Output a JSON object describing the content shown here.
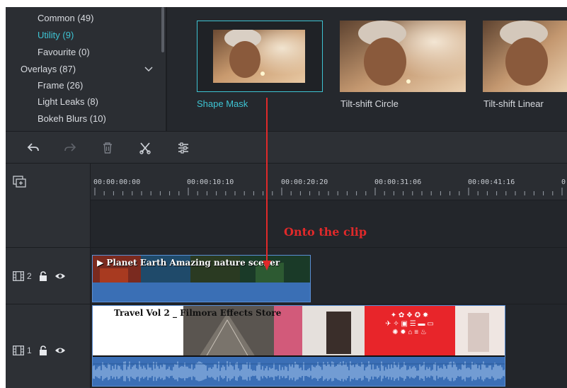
{
  "categories": [
    {
      "label": "Common (49)",
      "active": false
    },
    {
      "label": "Utility (9)",
      "active": true
    },
    {
      "label": "Favourite (0)",
      "active": false
    },
    {
      "label": "Overlays (87)",
      "active": false
    },
    {
      "label": "Frame (26)",
      "active": false
    },
    {
      "label": "Light Leaks (8)",
      "active": false
    },
    {
      "label": "Bokeh Blurs (10)",
      "active": false
    }
  ],
  "effects": [
    {
      "label": "Shape Mask",
      "selected": true
    },
    {
      "label": "Tilt-shift Circle",
      "selected": false
    },
    {
      "label": "Tilt-shift Linear",
      "selected": false
    }
  ],
  "toolbar": {
    "icons": [
      "undo-icon",
      "redo-icon",
      "delete-icon",
      "cut-icon",
      "adjust-icon"
    ]
  },
  "ruler": {
    "timecodes": [
      "00:00:00:00",
      "00:00:10:10",
      "00:00:20:20",
      "00:00:31:06",
      "00:00:41:16"
    ]
  },
  "tracks": [
    {
      "number": "2",
      "clip_title": "Planet Earth  Amazing nature scener"
    },
    {
      "number": "1",
      "clip_title": "Travel Vol 2 _ Filmora Effects Store"
    }
  ],
  "annotation": {
    "text": "Onto the clip"
  },
  "colors": {
    "accent": "#3ec4d3",
    "annotation": "#e0292a",
    "clip": "#3b6fb6"
  }
}
